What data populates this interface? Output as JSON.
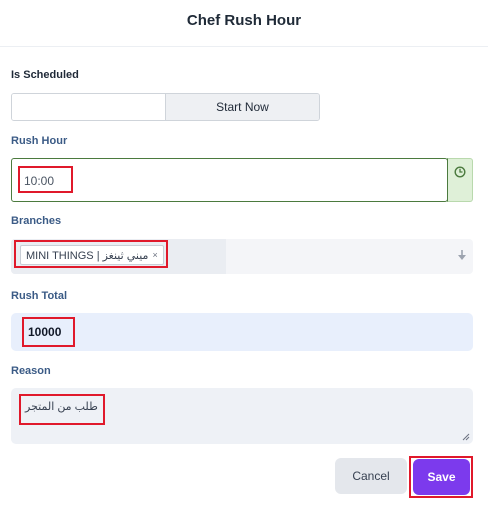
{
  "dialog": {
    "title": "Chef Rush Hour"
  },
  "schedule": {
    "label": "Is Scheduled",
    "options": [
      "",
      "Start Now"
    ],
    "selected": "Start Now"
  },
  "rush_hour": {
    "label": "Rush Hour",
    "value": "10:00",
    "icon": "clock-icon"
  },
  "branches": {
    "label": "Branches",
    "selected_tag": "MINI THINGS | ميني ثينغز",
    "remove_glyph": "×",
    "icon": "dropdown-arrow-icon"
  },
  "rush_total": {
    "label": "Rush Total",
    "value": "10000"
  },
  "reason": {
    "label": "Reason",
    "value": "طلب من المتجر"
  },
  "actions": {
    "cancel": "Cancel",
    "save": "Save"
  },
  "colors": {
    "accent": "#7c3aed",
    "success_border": "#4b7a3e",
    "success_addon": "#dff0d8",
    "highlight": "#e0192b",
    "label_blue": "#3b5b86"
  }
}
